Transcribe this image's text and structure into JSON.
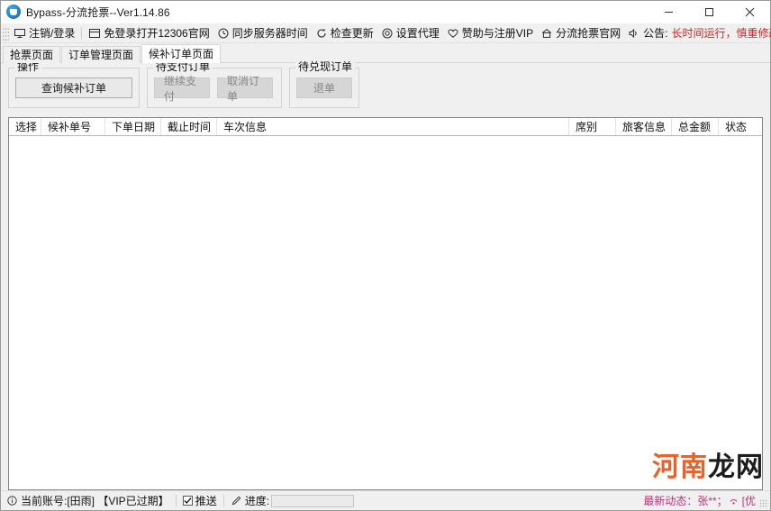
{
  "window": {
    "title": "Bypass-分流抢票--Ver1.14.86",
    "app_icon": "app-logo-icon",
    "minimize_label": "—",
    "maximize_label": "□",
    "close_label": "✕"
  },
  "toolbar": {
    "items": [
      {
        "icon": "monitor-icon",
        "label": "注销/登录"
      },
      {
        "icon": "window-icon",
        "label": "免登录打开12306官网"
      },
      {
        "icon": "clock-icon",
        "label": "同步服务器时间"
      },
      {
        "icon": "refresh-icon",
        "label": "检查更新"
      },
      {
        "icon": "target-icon",
        "label": "设置代理"
      },
      {
        "icon": "heart-icon",
        "label": "赞助与注册VIP"
      },
      {
        "icon": "home-icon",
        "label": "分流抢票官网"
      },
      {
        "icon": "speaker-icon",
        "label": "公告:"
      }
    ],
    "notice": "长时间运行，慎重修改间隔，建议默认！",
    "notice_color": "#cf2222"
  },
  "tabs": [
    {
      "label": "抢票页面",
      "active": false
    },
    {
      "label": "订单管理页面",
      "active": false
    },
    {
      "label": "候补订单页面",
      "active": true
    }
  ],
  "groups": [
    {
      "title": "操作",
      "buttons": [
        {
          "label": "查询候补订单",
          "disabled": false,
          "size": "wide"
        }
      ]
    },
    {
      "title": "待支付订单",
      "buttons": [
        {
          "label": "继续支付",
          "disabled": true,
          "size": "mid"
        },
        {
          "label": "取消订单",
          "disabled": true,
          "size": "mid"
        }
      ]
    },
    {
      "title": "待兑现订单",
      "buttons": [
        {
          "label": "退单",
          "disabled": true,
          "size": "mid"
        }
      ]
    }
  ],
  "grid": {
    "columns": [
      {
        "label": "选择",
        "width": 36
      },
      {
        "label": "候补单号",
        "width": 71
      },
      {
        "label": "下单日期",
        "width": 62
      },
      {
        "label": "截止时间",
        "width": 62
      },
      {
        "label": "车次信息",
        "width": 0
      },
      {
        "label": "席别",
        "width": 52
      },
      {
        "label": "旅客信息",
        "width": 62
      },
      {
        "label": "总金额",
        "width": 52
      },
      {
        "label": "状态",
        "width": 52
      }
    ],
    "rows": []
  },
  "statusbar": {
    "account_icon": "info-icon",
    "account_text": "当前账号:[田雨] 【VIP已过期】",
    "push_checked": true,
    "push_label": "推送",
    "progress_icon": "pencil-icon",
    "progress_label": "进度:",
    "progress_value": "",
    "latest_icon": "news-icon",
    "latest_text": "最新动态：张**；",
    "latest_tail": "[优",
    "latest_color": "#b8327a"
  },
  "watermark": {
    "part_a": "河南",
    "part_b": "龙网",
    "color_a": "#e8622a",
    "color_b": "#1c1c1c"
  }
}
